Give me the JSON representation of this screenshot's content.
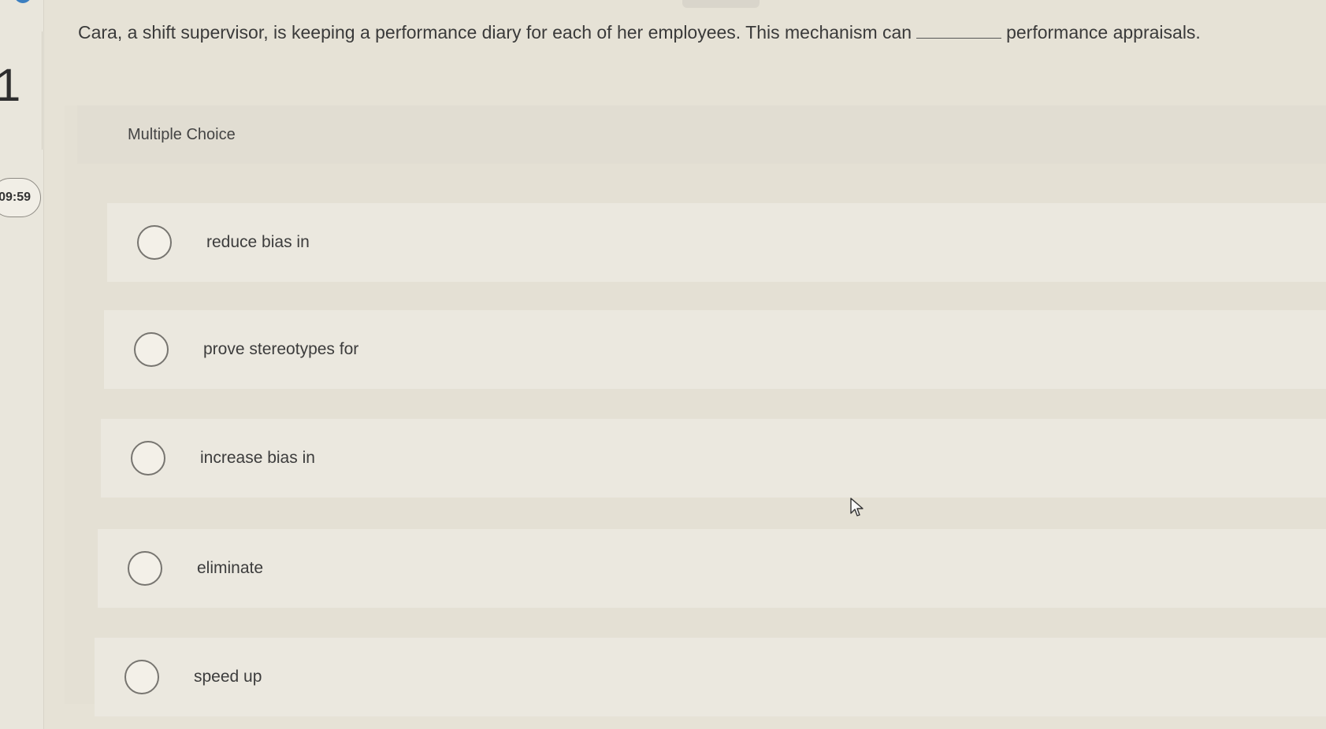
{
  "sidebar": {
    "question_number": "1",
    "timer": "09:59"
  },
  "question": {
    "text_before": "Cara, a shift supervisor, is keeping a performance diary for each of her employees. This mechanism can",
    "text_after": "performance appraisals."
  },
  "section": {
    "label": "Multiple Choice"
  },
  "choices": [
    {
      "label": "reduce bias in",
      "selected": false
    },
    {
      "label": "prove stereotypes for",
      "selected": false
    },
    {
      "label": "increase bias in",
      "selected": false
    },
    {
      "label": "eliminate",
      "selected": false
    },
    {
      "label": "speed up",
      "selected": false
    }
  ],
  "colors": {
    "background": "#e6e2d6",
    "choice_row": "#ebe8df",
    "radio_border": "#777570",
    "accent": "#3c7fc0"
  }
}
